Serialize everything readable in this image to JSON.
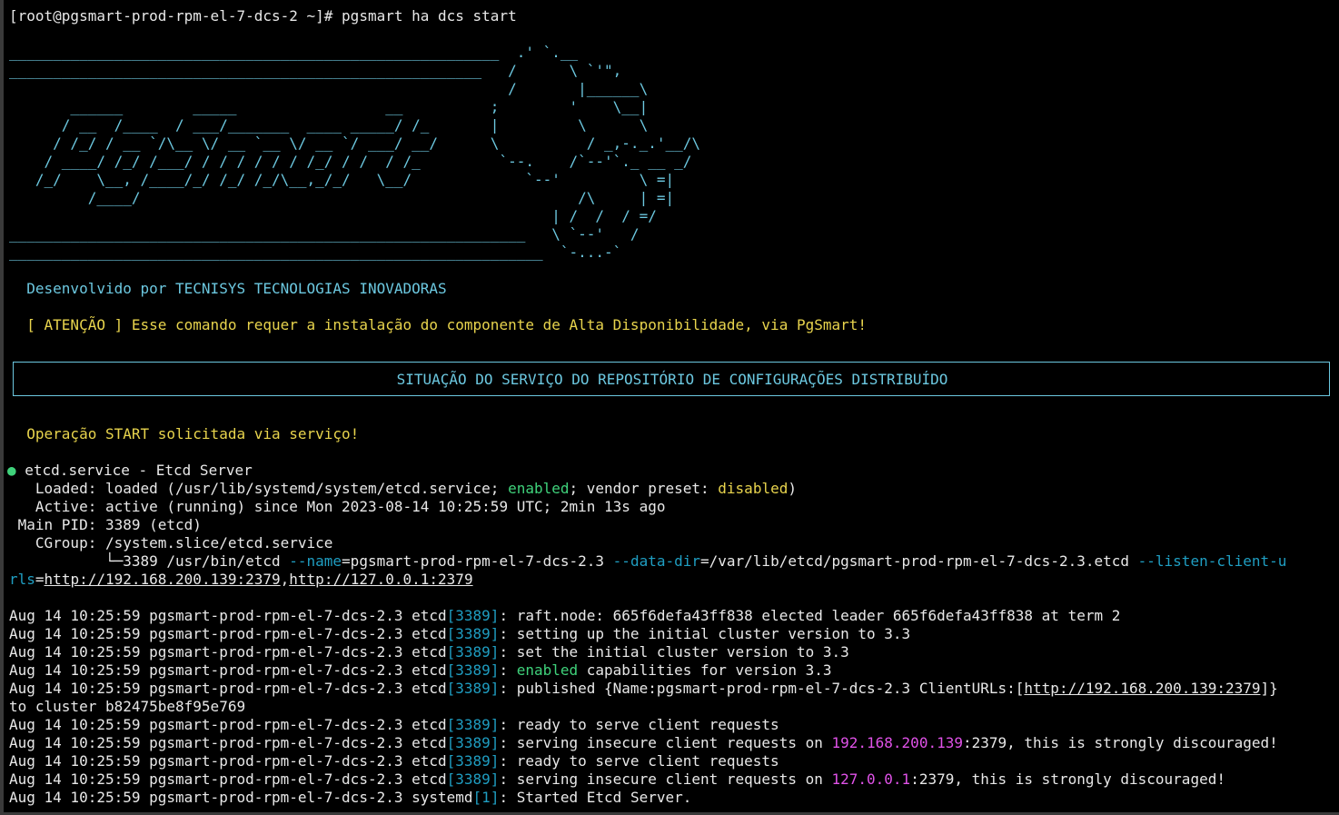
{
  "prompt": "[root@pgsmart-prod-rpm-el-7-dcs-2 ~]# pgsmart ha dcs start",
  "banner": [
    "________________________________________________________  .' `.__",
    "______________________________________________________   /      \\ `'\",",
    "                                                         /       |______\\",
    "       ______        _____                 __          ;        '    \\__|",
    "      / __  /____  / ___/_______  ____ _____/ /_       |         \\      \\",
    "     / /_/ / __ `/\\__ \\/ __ `__ \\/ __ `/ ___/ __/      \\          / _,-._.'__/\\",
    "    / ____/ /_/ /___/ / / / / / / /_/ / /  / /_         `--.    /`--'`._ __ _/",
    "   /_/    \\__, /____/_/ /_/ /_/\\__,_/_/   \\__/             `--'         \\ =|",
    "         /____/                                                  /\\     | =|",
    "                                                              | /  /  / =/",
    "___________________________________________________________   \\ `--'   /",
    "_____________________________________________________________  `-...-`"
  ],
  "developer": "  Desenvolvido por TECNISYS TECNOLOGIAS INOVADORAS",
  "warning": "  [ ATENÇÃO ] Esse comando requer a instalação do componente de Alta Disponibilidade, via PgSmart!",
  "box_title": "SITUAÇÃO DO SERVIÇO DO REPOSITÓRIO DE CONFIGURAÇÕES DISTRIBUÍDO",
  "operation": "  Operação START solicitada via serviço!",
  "status": {
    "dot": "●",
    "unit": " etcd.service - Etcd Server",
    "loaded_a": "   Loaded: loaded (/usr/lib/systemd/system/etcd.service; ",
    "loaded_enabled": "enabled",
    "loaded_b": "; vendor preset: ",
    "loaded_disabled": "disabled",
    "loaded_c": ")",
    "active": "   Active: active (running) since Mon 2023-08-14 10:25:59 UTC; 2min 13s ago",
    "pid": " Main PID: 3389 (etcd)",
    "cgroup": "   CGroup: /system.slice/etcd.service",
    "proc_a": "           └─3389 /usr/bin/etcd ",
    "opt_name": "--name",
    "proc_b": "=pgsmart-prod-rpm-el-7-dcs-2.3 ",
    "opt_datadir": "--data-dir",
    "proc_c": "=/var/lib/etcd/pgsmart-prod-rpm-el-7-dcs-2.3.etcd ",
    "opt_listen1": "--listen-client-u",
    "opt_listen2": "rls",
    "proc_d": "=",
    "url1": "http://192.168.200.139:2379",
    "comma": ",",
    "url2": "http://127.0.0.1:2379"
  },
  "log_prefix": "Aug 14 10:25:59 pgsmart-prod-rpm-el-7-dcs-2.3 etcd",
  "log_pid": "[3389]",
  "logs": [
    ": raft.node: 665f6defa43ff838 elected leader 665f6defa43ff838 at term 2",
    ": setting up the initial cluster version to 3.3",
    ": set the initial cluster version to 3.3"
  ],
  "log4_word": "enabled",
  "log4_rest": " capabilities for version 3.3",
  "log5_a": ": published {Name:pgsmart-prod-rpm-el-7-dcs-2.3 ClientURLs:[",
  "log5_url": "http://192.168.200.139:2379",
  "log5_b": "]}",
  "log5_cont": "to cluster b82475be8f95e769",
  "log6": ": ready to serve client requests",
  "log7_a": ": serving insecure client requests on ",
  "log7_ip": "192.168.200.139",
  "log7_b": ":2379, this is strongly discouraged!",
  "log8": ": ready to serve client requests",
  "log9_a": ": serving insecure client requests on ",
  "log9_ip": "127.0.0.1",
  "log9_b": ":2379, this is strongly discouraged!",
  "last_prefix": "Aug 14 10:25:59 pgsmart-prod-rpm-el-7-dcs-2.3 systemd",
  "last_pid": "[1]",
  "last_msg": ": Started Etcd Server.",
  "colors": {
    "background": "#000000",
    "text": "#e8e8e8",
    "cyan": "#6cc8e0",
    "yellow": "#e8d44d",
    "green": "#3fd27b",
    "magenta": "#e052e8",
    "teal": "#1f9ec2"
  }
}
